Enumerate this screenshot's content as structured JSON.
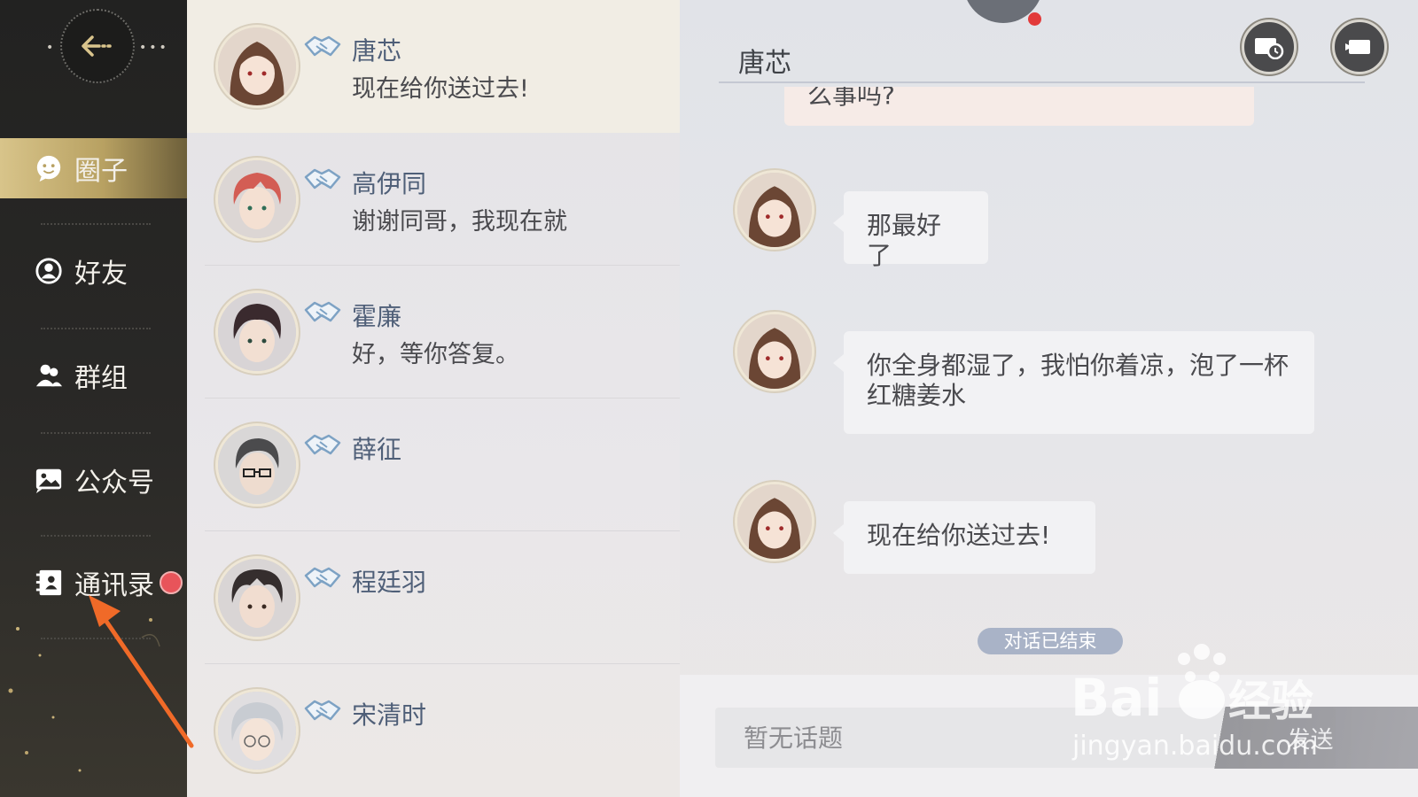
{
  "sidebar": {
    "items": [
      {
        "label": "圈子",
        "icon": "chat-bubble-icon",
        "active": true
      },
      {
        "label": "好友",
        "icon": "friend-icon",
        "active": false
      },
      {
        "label": "群组",
        "icon": "group-icon",
        "active": false
      },
      {
        "label": "公众号",
        "icon": "official-account-icon",
        "active": false
      },
      {
        "label": "通讯录",
        "icon": "contacts-book-icon",
        "active": false,
        "badge": true
      }
    ]
  },
  "contacts": [
    {
      "name": "唐芯",
      "message": "现在给你送过去!",
      "active": true
    },
    {
      "name": "高伊同",
      "message": "谢谢同哥，我现在就",
      "active": false
    },
    {
      "name": "霍廉",
      "message": "好，等你答复。",
      "active": false
    },
    {
      "name": "薛征",
      "message": "",
      "active": false
    },
    {
      "name": "程廷羽",
      "message": "",
      "active": false
    },
    {
      "name": "宋清时",
      "message": "",
      "active": false
    }
  ],
  "chat": {
    "title": "唐芯",
    "partial_message": "么事吗?",
    "messages": [
      {
        "text": "那最好了"
      },
      {
        "text": "你全身都湿了，我怕你着凉，泡了一杯红糖姜水"
      },
      {
        "text": "现在给你送过去!"
      }
    ],
    "ended_label": "对话已结束",
    "input_placeholder": "暂无话题",
    "send_label": "发送"
  },
  "watermark": {
    "text": "jingyan.baidu.com",
    "brand": "Bai 经验"
  },
  "colors": {
    "accent_gold": "#c9b37a",
    "badge_red": "#e8545a",
    "name_blue": "#4f5f78",
    "ended_pill": "#a9b3c7"
  }
}
